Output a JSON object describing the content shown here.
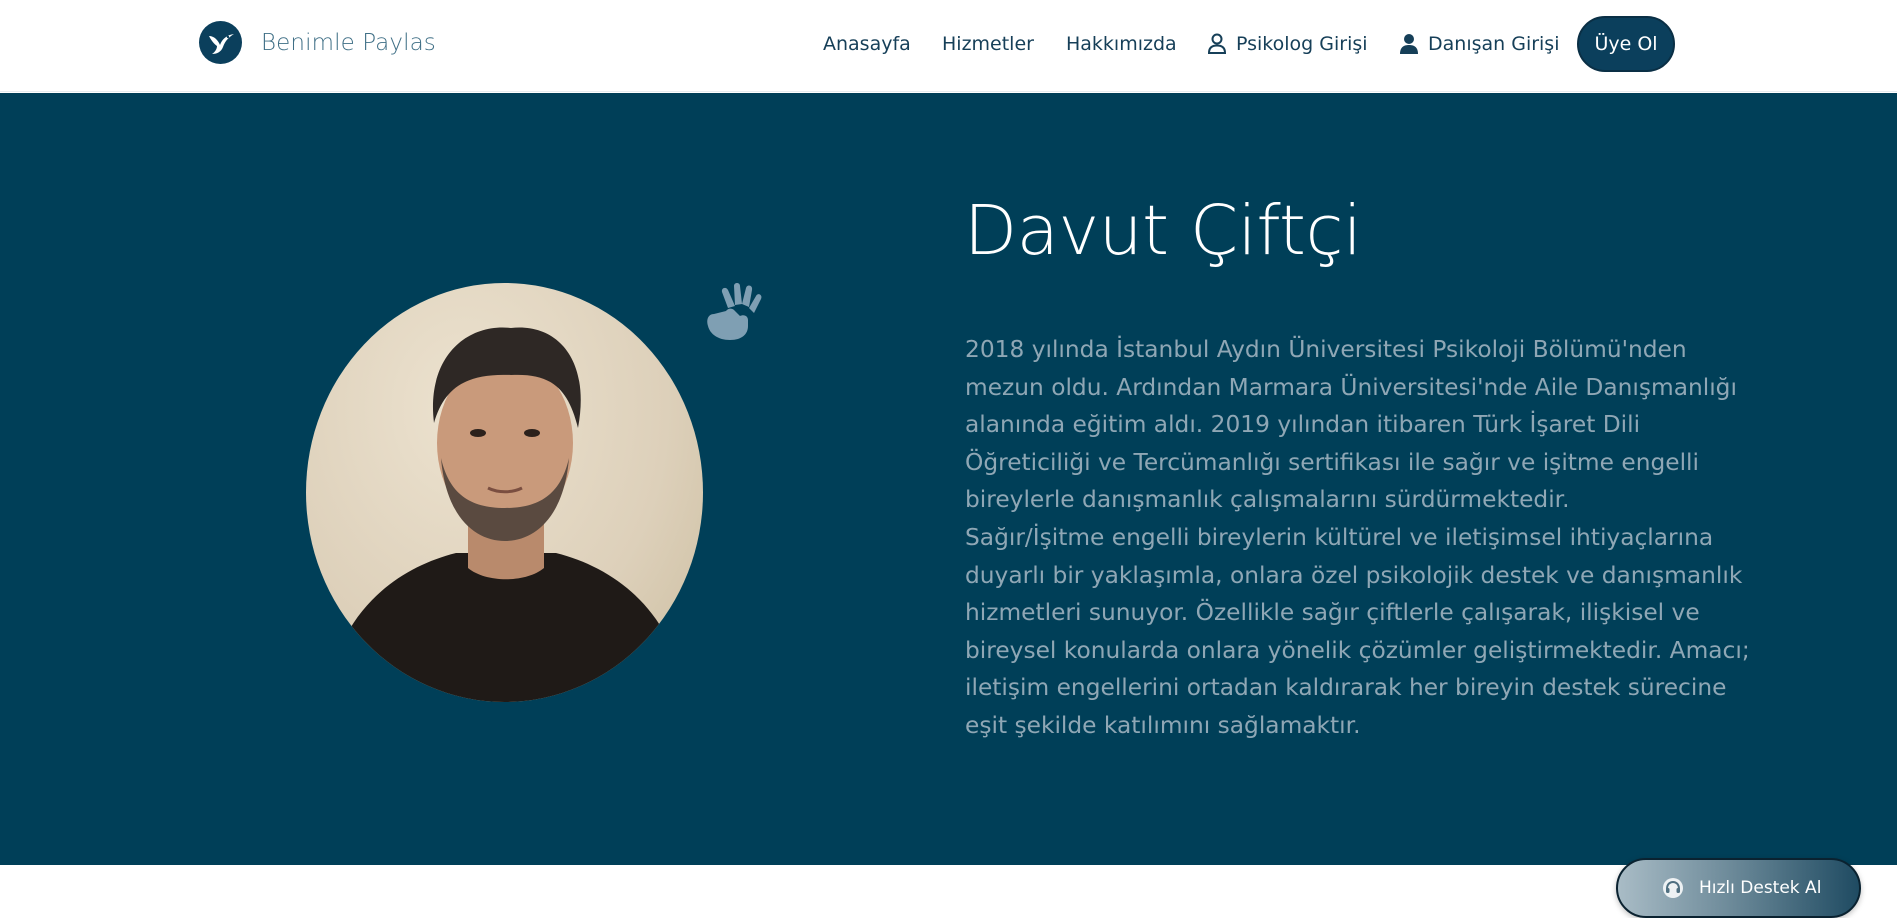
{
  "header": {
    "brand_name": "Benimle Paylas",
    "nav": {
      "home": "Anasayfa",
      "services": "Hizmetler",
      "about": "Hakkımızda",
      "psychologist_login": "Psikolog Girişi",
      "client_login": "Danışan Girişi"
    },
    "signup_label": "Üye Ol"
  },
  "profile": {
    "name": "Davut Çiftçi",
    "bio_paragraphs": [
      "2018 yılında İstanbul Aydın Üniversitesi Psikoloji Bölümü'nden mezun oldu. Ardından Marmara Üniversitesi'nde Aile Danışmanlığı alanında eğitim aldı. 2019 yılından itibaren Türk İşaret Dili Öğreticiliği ve Tercümanlığı sertifikası ile sağır ve işitme engelli bireylerle danışmanlık çalışmalarını sürdürmektedir.",
      "Sağır/İşitme engelli bireylerin kültürel ve iletişimsel ihtiyaçlarına duyarlı bir yaklaşımla, onlara özel psikolojik destek ve danışmanlık hizmetleri sunuyor. Özellikle sağır çiftlerle çalışarak, ilişkisel ve bireysel konularda onlara yönelik çözümler geliştirmektedir. Amacı; iletişim engellerini ortadan kaldırarak her bireyin destek sürecine eşit şekilde katılımını sağlamaktır."
    ]
  },
  "support_button": {
    "label": "Hızlı Destek Al"
  },
  "icons": {
    "brand": "bird-logo-icon",
    "psychologist": "user-outline-icon",
    "client": "user-solid-icon",
    "sign_language": "sign-language-hands-icon",
    "support": "headset-icon"
  },
  "colors": {
    "brand": "#0b3f5c",
    "hero_background": "#003f58",
    "bio_text": "#8fa7b5"
  }
}
